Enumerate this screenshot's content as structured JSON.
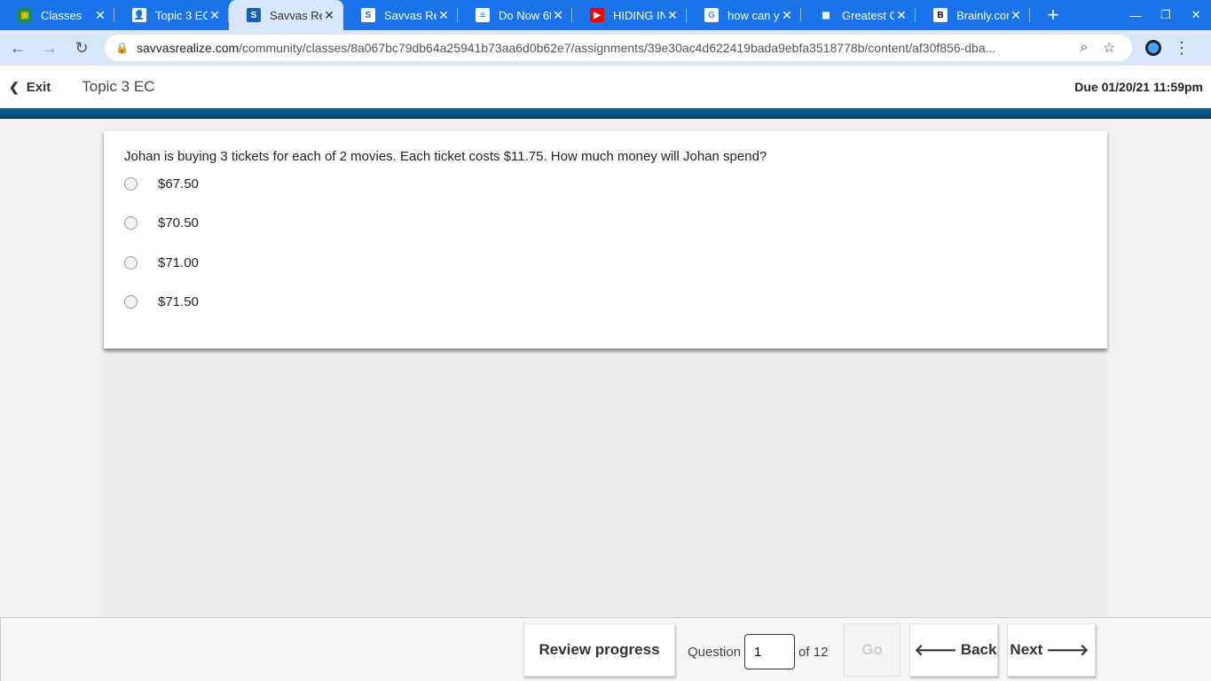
{
  "browser": {
    "tabs": [
      {
        "title": "Classes",
        "icon": "google-classroom-icon",
        "active": false
      },
      {
        "title": "Topic 3 EC",
        "icon": "classroom-assignment-icon",
        "active": false
      },
      {
        "title": "Savvas Re",
        "icon": "savvas-icon",
        "active": true
      },
      {
        "title": "Savvas Re",
        "icon": "savvas-icon",
        "active": false
      },
      {
        "title": "Do Now 6t",
        "icon": "google-docs-icon",
        "active": false
      },
      {
        "title": "HIDING INS",
        "icon": "youtube-icon",
        "active": false
      },
      {
        "title": "how can yo",
        "icon": "google-icon",
        "active": false
      },
      {
        "title": "Greatest C",
        "icon": "grid-icon",
        "active": false
      },
      {
        "title": "Brainly.con",
        "icon": "brainly-icon",
        "active": false
      }
    ],
    "close_glyph": "✕",
    "new_tab_glyph": "+",
    "url_host": "savvasrealize.com",
    "url_path": "/community/classes/8a067bc79db64a25941b73aa6d0b62e7/assignments/39e30ac4d622419bada9ebfa3518778b/content/af30f856-dba..."
  },
  "header": {
    "exit_label": "Exit",
    "assignment_title": "Topic 3 EC",
    "due": "Due 01/20/21 11:59pm"
  },
  "question": {
    "text": "Johan is buying 3 tickets for each of 2 movies. Each ticket costs $11.75. How much money will Johan spend?",
    "options": [
      "$67.50",
      "$70.50",
      "$71.00",
      "$71.50"
    ]
  },
  "footer": {
    "review_label": "Review progress",
    "question_label": "Question",
    "current_question": "1",
    "total_label": "of 12",
    "go_label": "Go",
    "back_label": "Back",
    "next_label": "Next"
  },
  "colors": {
    "tabstrip": "#1a73e8",
    "toolbar": "#d8e6fb",
    "header_bar": "#0d5f8f"
  }
}
